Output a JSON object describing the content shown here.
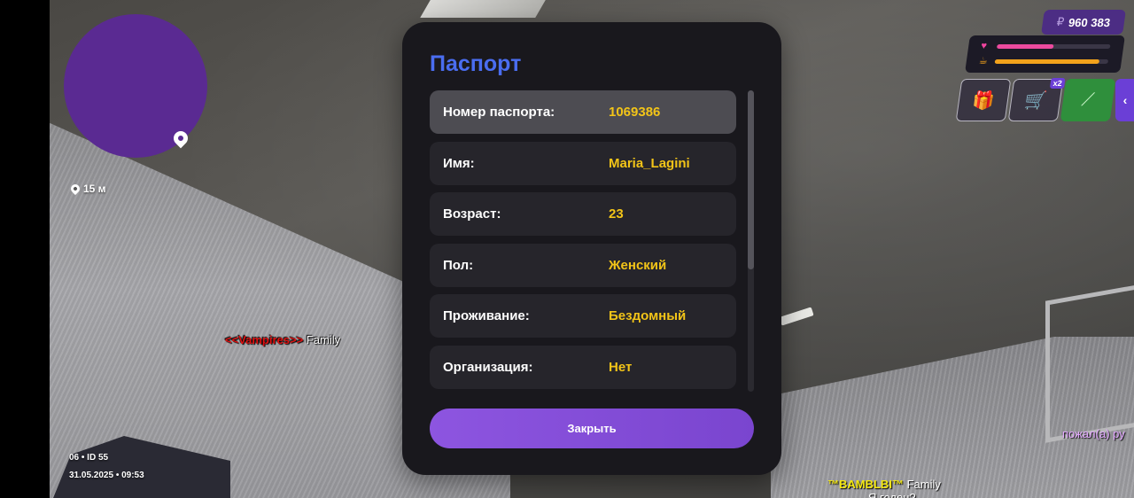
{
  "hud": {
    "distance": "15 м",
    "player_tag": {
      "clan": "<<Vampires>>",
      "family": "Family"
    },
    "session": {
      "id_line": "06 • ID 55",
      "datetime": "31.05.2025 • 09:53"
    },
    "chat_right": "пожал(а) ру",
    "bottom_tag": {
      "clan": "™BAMBLBI™",
      "family": "Family",
      "sub": "Я годен?"
    },
    "money": {
      "currency": "₽",
      "amount": "960 383"
    },
    "stats": {
      "health_pct": 50,
      "hunger_pct": 92,
      "health_color": "#ec4a9e",
      "hunger_color": "#f2a21b"
    },
    "buttons": {
      "cart_badge": "x2",
      "side_arrow": "‹"
    },
    "icons": {
      "gift": "🎁",
      "cart": "🛒",
      "weapon": "⟋",
      "heart": "♥",
      "food": "☕"
    }
  },
  "passport": {
    "title": "Паспорт",
    "rows": [
      {
        "label": "Номер паспорта:",
        "value": "1069386"
      },
      {
        "label": "Имя:",
        "value": "Maria_Lagini"
      },
      {
        "label": "Возраст:",
        "value": "23"
      },
      {
        "label": "Пол:",
        "value": "Женский"
      },
      {
        "label": "Проживание:",
        "value": "Бездомный"
      },
      {
        "label": "Организация:",
        "value": "Нет"
      }
    ],
    "close_label": "Закрыть",
    "accent_color": "#4a6df0",
    "value_color": "#f2c418"
  }
}
